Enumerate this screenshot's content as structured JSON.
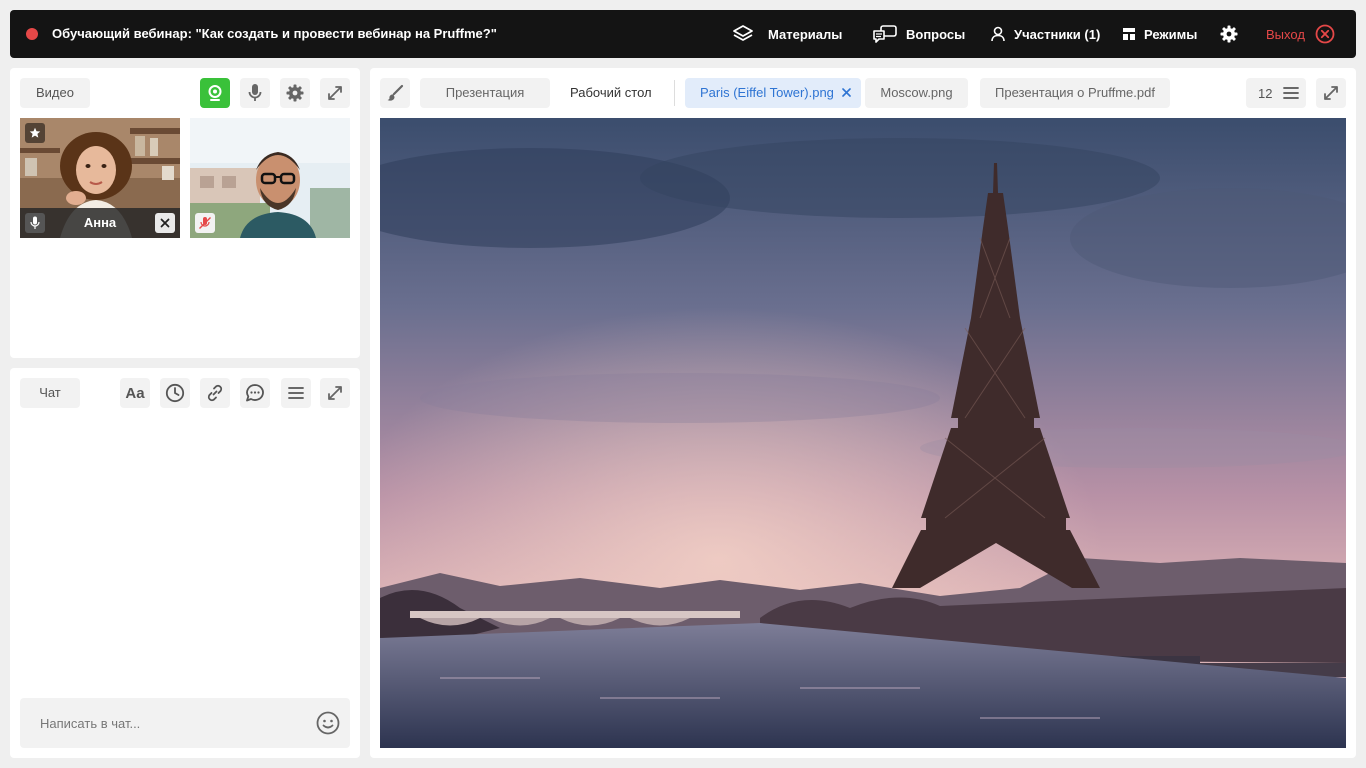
{
  "header": {
    "title": "Обучающий вебинар: \"Как создать и провести вебинар на Pruffme?\"",
    "materials_label": "Материалы",
    "questions_label": "Вопросы",
    "participants_label": "Участники (1)",
    "modes_label": "Режимы",
    "exit_label": "Выход"
  },
  "video": {
    "tab_label": "Видео",
    "tiles": [
      {
        "name": "Анна"
      }
    ]
  },
  "chat": {
    "tab_label": "Чат",
    "font_button_label": "Aa",
    "input_placeholder": "Написать в чат..."
  },
  "board": {
    "tabs": [
      {
        "label": "Презентация"
      },
      {
        "label": "Рабочий стол"
      },
      {
        "label": "Paris (Eiffel Tower).png"
      },
      {
        "label": "Moscow.png"
      },
      {
        "label": "Презентация о Pruffme.pdf"
      }
    ],
    "page_count": "12"
  },
  "colors": {
    "accent_blue": "#2e74d3",
    "record_red": "#e54848",
    "camera_green": "#3ac13a"
  }
}
